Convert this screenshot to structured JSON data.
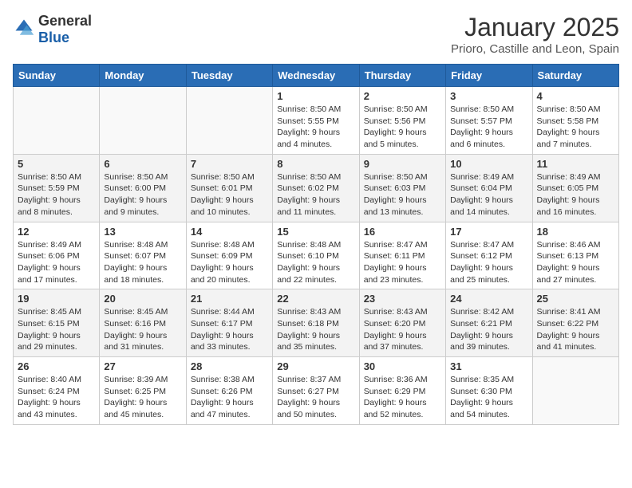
{
  "header": {
    "logo_general": "General",
    "logo_blue": "Blue",
    "title": "January 2025",
    "subtitle": "Prioro, Castille and Leon, Spain"
  },
  "weekdays": [
    "Sunday",
    "Monday",
    "Tuesday",
    "Wednesday",
    "Thursday",
    "Friday",
    "Saturday"
  ],
  "weeks": [
    [
      {
        "day": "",
        "info": ""
      },
      {
        "day": "",
        "info": ""
      },
      {
        "day": "",
        "info": ""
      },
      {
        "day": "1",
        "info": "Sunrise: 8:50 AM\nSunset: 5:55 PM\nDaylight: 9 hours\nand 4 minutes."
      },
      {
        "day": "2",
        "info": "Sunrise: 8:50 AM\nSunset: 5:56 PM\nDaylight: 9 hours\nand 5 minutes."
      },
      {
        "day": "3",
        "info": "Sunrise: 8:50 AM\nSunset: 5:57 PM\nDaylight: 9 hours\nand 6 minutes."
      },
      {
        "day": "4",
        "info": "Sunrise: 8:50 AM\nSunset: 5:58 PM\nDaylight: 9 hours\nand 7 minutes."
      }
    ],
    [
      {
        "day": "5",
        "info": "Sunrise: 8:50 AM\nSunset: 5:59 PM\nDaylight: 9 hours\nand 8 minutes."
      },
      {
        "day": "6",
        "info": "Sunrise: 8:50 AM\nSunset: 6:00 PM\nDaylight: 9 hours\nand 9 minutes."
      },
      {
        "day": "7",
        "info": "Sunrise: 8:50 AM\nSunset: 6:01 PM\nDaylight: 9 hours\nand 10 minutes."
      },
      {
        "day": "8",
        "info": "Sunrise: 8:50 AM\nSunset: 6:02 PM\nDaylight: 9 hours\nand 11 minutes."
      },
      {
        "day": "9",
        "info": "Sunrise: 8:50 AM\nSunset: 6:03 PM\nDaylight: 9 hours\nand 13 minutes."
      },
      {
        "day": "10",
        "info": "Sunrise: 8:49 AM\nSunset: 6:04 PM\nDaylight: 9 hours\nand 14 minutes."
      },
      {
        "day": "11",
        "info": "Sunrise: 8:49 AM\nSunset: 6:05 PM\nDaylight: 9 hours\nand 16 minutes."
      }
    ],
    [
      {
        "day": "12",
        "info": "Sunrise: 8:49 AM\nSunset: 6:06 PM\nDaylight: 9 hours\nand 17 minutes."
      },
      {
        "day": "13",
        "info": "Sunrise: 8:48 AM\nSunset: 6:07 PM\nDaylight: 9 hours\nand 18 minutes."
      },
      {
        "day": "14",
        "info": "Sunrise: 8:48 AM\nSunset: 6:09 PM\nDaylight: 9 hours\nand 20 minutes."
      },
      {
        "day": "15",
        "info": "Sunrise: 8:48 AM\nSunset: 6:10 PM\nDaylight: 9 hours\nand 22 minutes."
      },
      {
        "day": "16",
        "info": "Sunrise: 8:47 AM\nSunset: 6:11 PM\nDaylight: 9 hours\nand 23 minutes."
      },
      {
        "day": "17",
        "info": "Sunrise: 8:47 AM\nSunset: 6:12 PM\nDaylight: 9 hours\nand 25 minutes."
      },
      {
        "day": "18",
        "info": "Sunrise: 8:46 AM\nSunset: 6:13 PM\nDaylight: 9 hours\nand 27 minutes."
      }
    ],
    [
      {
        "day": "19",
        "info": "Sunrise: 8:45 AM\nSunset: 6:15 PM\nDaylight: 9 hours\nand 29 minutes."
      },
      {
        "day": "20",
        "info": "Sunrise: 8:45 AM\nSunset: 6:16 PM\nDaylight: 9 hours\nand 31 minutes."
      },
      {
        "day": "21",
        "info": "Sunrise: 8:44 AM\nSunset: 6:17 PM\nDaylight: 9 hours\nand 33 minutes."
      },
      {
        "day": "22",
        "info": "Sunrise: 8:43 AM\nSunset: 6:18 PM\nDaylight: 9 hours\nand 35 minutes."
      },
      {
        "day": "23",
        "info": "Sunrise: 8:43 AM\nSunset: 6:20 PM\nDaylight: 9 hours\nand 37 minutes."
      },
      {
        "day": "24",
        "info": "Sunrise: 8:42 AM\nSunset: 6:21 PM\nDaylight: 9 hours\nand 39 minutes."
      },
      {
        "day": "25",
        "info": "Sunrise: 8:41 AM\nSunset: 6:22 PM\nDaylight: 9 hours\nand 41 minutes."
      }
    ],
    [
      {
        "day": "26",
        "info": "Sunrise: 8:40 AM\nSunset: 6:24 PM\nDaylight: 9 hours\nand 43 minutes."
      },
      {
        "day": "27",
        "info": "Sunrise: 8:39 AM\nSunset: 6:25 PM\nDaylight: 9 hours\nand 45 minutes."
      },
      {
        "day": "28",
        "info": "Sunrise: 8:38 AM\nSunset: 6:26 PM\nDaylight: 9 hours\nand 47 minutes."
      },
      {
        "day": "29",
        "info": "Sunrise: 8:37 AM\nSunset: 6:27 PM\nDaylight: 9 hours\nand 50 minutes."
      },
      {
        "day": "30",
        "info": "Sunrise: 8:36 AM\nSunset: 6:29 PM\nDaylight: 9 hours\nand 52 minutes."
      },
      {
        "day": "31",
        "info": "Sunrise: 8:35 AM\nSunset: 6:30 PM\nDaylight: 9 hours\nand 54 minutes."
      },
      {
        "day": "",
        "info": ""
      }
    ]
  ]
}
